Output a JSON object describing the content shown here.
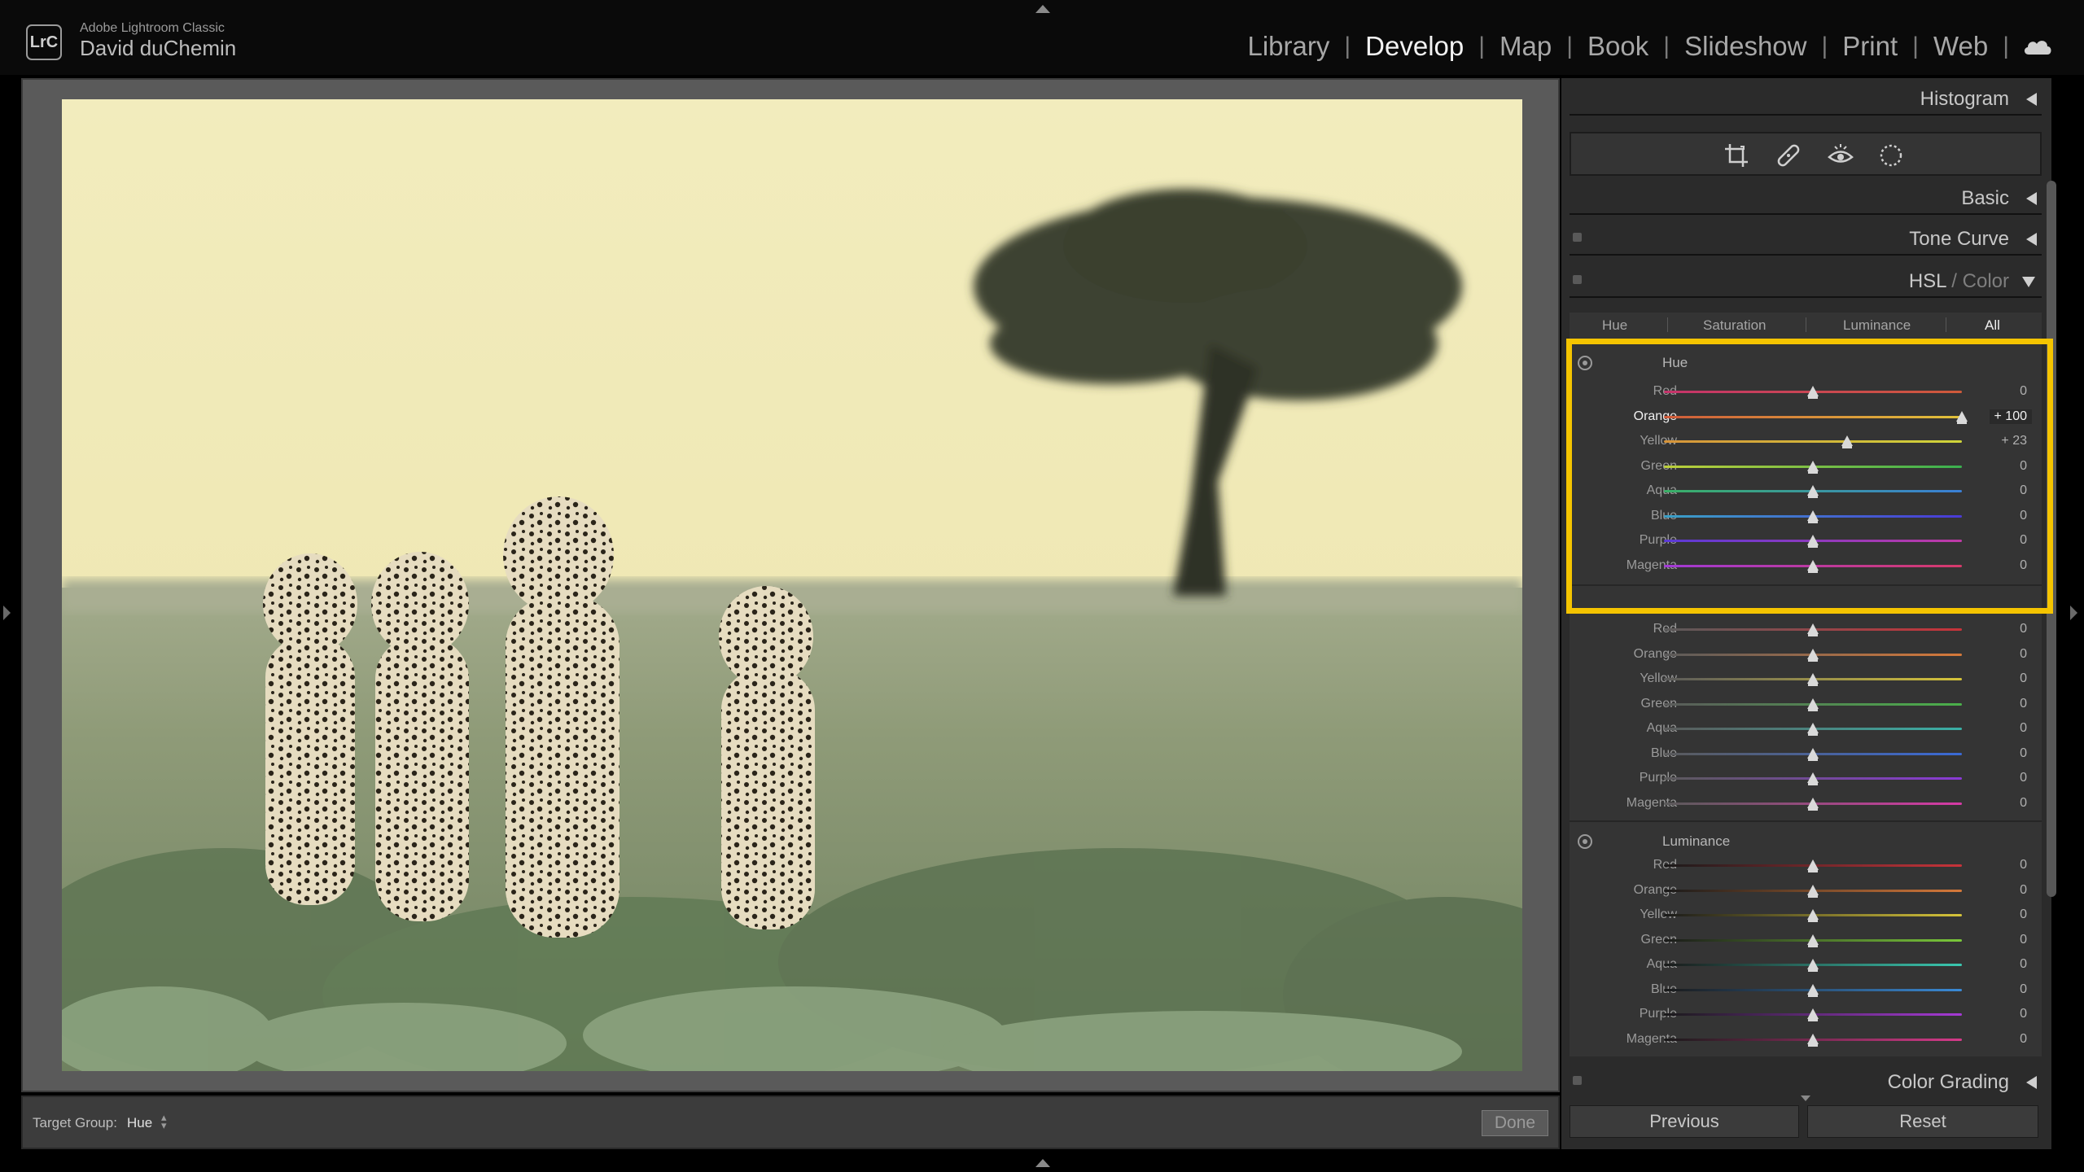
{
  "app": {
    "logo_text": "LrC",
    "product_name": "Adobe Lightroom Classic",
    "user_name": "David duChemin"
  },
  "modules": [
    {
      "label": "Library",
      "active": false
    },
    {
      "label": "Develop",
      "active": true
    },
    {
      "label": "Map",
      "active": false
    },
    {
      "label": "Book",
      "active": false
    },
    {
      "label": "Slideshow",
      "active": false
    },
    {
      "label": "Print",
      "active": false
    },
    {
      "label": "Web",
      "active": false
    }
  ],
  "toolbar": {
    "target_group_label": "Target Group:",
    "target_group_value": "Hue",
    "done_label": "Done"
  },
  "panels": {
    "histogram": "Histogram",
    "basic": "Basic",
    "tone_curve": "Tone Curve",
    "hsl": "HSL",
    "hsl_separator": " / ",
    "color": "Color",
    "color_grading": "Color Grading"
  },
  "tabs": [
    {
      "label": "Hue",
      "active": false
    },
    {
      "label": "Saturation",
      "active": false
    },
    {
      "label": "Luminance",
      "active": false
    },
    {
      "label": "All",
      "active": true
    }
  ],
  "hue": {
    "label": "Hue",
    "sliders": [
      {
        "name": "Red",
        "value": "0",
        "position": 0
      },
      {
        "name": "Orange",
        "value": "+ 100",
        "position": 100
      },
      {
        "name": "Yellow",
        "value": "+ 23",
        "position": 23
      },
      {
        "name": "Green",
        "value": "0",
        "position": 0
      },
      {
        "name": "Aqua",
        "value": "0",
        "position": 0
      },
      {
        "name": "Blue",
        "value": "0",
        "position": 0
      },
      {
        "name": "Purple",
        "value": "0",
        "position": 0
      },
      {
        "name": "Magenta",
        "value": "0",
        "position": 0
      }
    ]
  },
  "saturation": {
    "sliders": [
      {
        "name": "Red",
        "value": "0",
        "position": 0
      },
      {
        "name": "Orange",
        "value": "0",
        "position": 0
      },
      {
        "name": "Yellow",
        "value": "0",
        "position": 0
      },
      {
        "name": "Green",
        "value": "0",
        "position": 0
      },
      {
        "name": "Aqua",
        "value": "0",
        "position": 0
      },
      {
        "name": "Blue",
        "value": "0",
        "position": 0
      },
      {
        "name": "Purple",
        "value": "0",
        "position": 0
      },
      {
        "name": "Magenta",
        "value": "0",
        "position": 0
      }
    ]
  },
  "luminance": {
    "label": "Luminance",
    "sliders": [
      {
        "name": "Red",
        "value": "0",
        "position": 0
      },
      {
        "name": "Orange",
        "value": "0",
        "position": 0
      },
      {
        "name": "Yellow",
        "value": "0",
        "position": 0
      },
      {
        "name": "Green",
        "value": "0",
        "position": 0
      },
      {
        "name": "Aqua",
        "value": "0",
        "position": 0
      },
      {
        "name": "Blue",
        "value": "0",
        "position": 0
      },
      {
        "name": "Purple",
        "value": "0",
        "position": 0
      },
      {
        "name": "Magenta",
        "value": "0",
        "position": 0
      }
    ]
  },
  "buttons": {
    "previous": "Previous",
    "reset": "Reset"
  },
  "colors": {
    "highlight": "#f5c400",
    "panel_bg": "#2b2b2b",
    "section_bg": "#343434"
  }
}
